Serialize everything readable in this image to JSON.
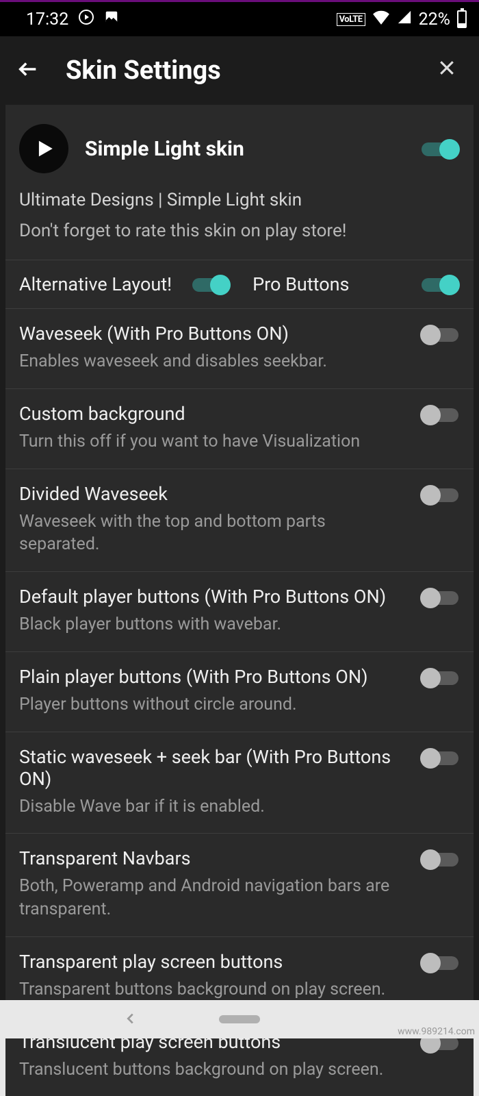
{
  "status": {
    "time": "17:32",
    "volte": "VoLTE",
    "battery_pct": "22%"
  },
  "appbar": {
    "title": "Skin Settings"
  },
  "hero": {
    "title": "Simple Light skin",
    "enabled": true
  },
  "desc": {
    "line1": "Ultimate Designs | Simple Light skin",
    "line2": "Don't forget to rate this skin on play store!"
  },
  "inline": {
    "alt_layout_label": "Alternative Layout!",
    "alt_layout_on": true,
    "pro_buttons_label": "Pro Buttons",
    "pro_buttons_on": true
  },
  "settings": [
    {
      "title": "Waveseek (With Pro Buttons ON)",
      "sub": "Enables waveseek and disables seekbar.",
      "on": false
    },
    {
      "title": "Custom background",
      "sub": "Turn this off if you want to have Visualization",
      "on": false
    },
    {
      "title": "Divided Waveseek",
      "sub": "Waveseek with the top and bottom parts separated.",
      "on": false
    },
    {
      "title": "Default player buttons (With Pro Buttons ON)",
      "sub": "Black player buttons with wavebar.",
      "on": false
    },
    {
      "title": "Plain player buttons (With Pro Buttons ON)",
      "sub": "Player buttons without circle around.",
      "on": false
    },
    {
      "title": "Static waveseek + seek bar (With Pro Buttons ON)",
      "sub": "Disable Wave bar if it is enabled.",
      "on": false
    },
    {
      "title": "Transparent Navbars",
      "sub": "Both, Poweramp and Android navigation bars are transparent.",
      "on": false
    },
    {
      "title": "Transparent play screen buttons",
      "sub": "Transparent buttons background on play screen.",
      "on": false
    },
    {
      "title": "Translucent play screen buttons",
      "sub": "Translucent buttons background on play screen.",
      "on": false
    }
  ],
  "watermark": "www.989214.com",
  "colors": {
    "accent": "#44d1c6",
    "bg_dark": "#1c1c1c",
    "bg_panel": "#2a2a2a"
  }
}
